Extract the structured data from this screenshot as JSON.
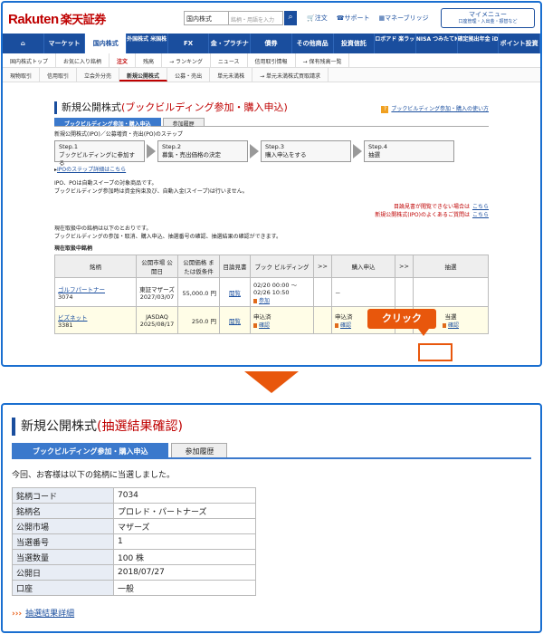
{
  "header": {
    "logo_en": "Rakuten",
    "logo_jp": "楽天証券",
    "search_select": "国内株式",
    "search_placeholder": "銘柄・用語を入力",
    "links": [
      "注文",
      "サポート",
      "マネーブリッジ"
    ],
    "mymenu_title": "マイメニュー",
    "mymenu_sub": "口座管理・入出金・振替など"
  },
  "nav": {
    "items": [
      "マーケット",
      "国内株式",
      "外国株式 米国株・海外ETF",
      "FX",
      "金・プラチナ",
      "債券",
      "その他商品",
      "投資信託",
      "ロボアド 楽ラップ",
      "NISA つみたてNISA",
      "確定拠出年金 iDeCo",
      "ポイント投資"
    ]
  },
  "subnav": {
    "items": [
      "国内株式トップ",
      "お気に入り銘柄",
      "注文",
      "残高",
      "→ ランキング",
      "ニュース",
      "信用取引情報",
      "→ 保有残高一覧"
    ]
  },
  "subnav2": {
    "items": [
      "現物取引",
      "信用取引",
      "立会外分売",
      "新規公開株式",
      "公募・売出",
      "単元未満株",
      "→ 単元未満株式買取請求"
    ]
  },
  "main": {
    "title_prefix": "新規公開株式",
    "title_suffix": "(ブックビルディング参加・購入申込)",
    "help": "ブックビルディング参加・購入の使い方",
    "tabs": [
      "ブックビルディング参加・購入申込",
      "参加履歴"
    ],
    "step_intro": "新規公開株式(IPO)／公募増資・売出(PO)のステップ",
    "steps": [
      {
        "head": "Step.1",
        "text": "ブックビルディングに参加する"
      },
      {
        "head": "Step.2",
        "text": "募集・売出価格の決定"
      },
      {
        "head": "Step.3",
        "text": "購入申込をする"
      },
      {
        "head": "Step.4",
        "text": "抽選"
      }
    ],
    "step_link": "IPOのステップ詳細はこちら",
    "note1": "IPO、POは自動スイープの対象商品です。",
    "note2": "ブックビルディング参加時は資金拘束及び、自動入金(スイープ)は行いません。",
    "warn1": "目論見書が閲覧できない場合は",
    "warn2": "新規公開株式(IPO)のよくあるご質問は",
    "here": "こちら",
    "list_intro1": "現在取扱中の銘柄は以下のとおりです。",
    "list_intro2": "ブックビルディングの参加・取消、購入申込、抽選番号の確認、抽選結果の確認ができます。",
    "list_heading": "現在取扱中銘柄",
    "table_headers": [
      "銘柄",
      "公開市場 公開日",
      "公開価格 または仮条件",
      "目論見書",
      "ブック ビルディング",
      ">>",
      "購入申込",
      ">>",
      "抽選"
    ],
    "rows": [
      {
        "name": "ゴルフパートナー",
        "code": "3074",
        "market": "東証マザーズ",
        "date": "2027/03/07",
        "price": "55,000.0 円",
        "doc": "閲覧",
        "bb": "02/20 00:00 ～ 02/26 10:50",
        "bb_action": "参加",
        "apply": "－",
        "lottery": ""
      },
      {
        "name": "ビズネット",
        "code": "3381",
        "market": "JASDAQ",
        "date": "2025/08/17",
        "price": "250.0 円",
        "doc": "閲覧",
        "bb": "申込済",
        "bb_action": "確認",
        "apply": "申込済",
        "apply_action": "確認",
        "lottery": "当選",
        "lottery_action": "確認"
      }
    ],
    "click_label": "クリック"
  },
  "result": {
    "title_prefix": "新規公開株式",
    "title_suffix": "(抽選結果確認)",
    "tabs": [
      "ブックビルディング参加・購入申込",
      "参加履歴"
    ],
    "message": "今回、お客様は以下の銘柄に当選しました。",
    "rows": [
      {
        "k": "銘柄コード",
        "v": "7034"
      },
      {
        "k": "銘柄名",
        "v": "プロレド・パートナーズ"
      },
      {
        "k": "公開市場",
        "v": "マザーズ"
      },
      {
        "k": "当選番号",
        "v": "1"
      },
      {
        "k": "当選数量",
        "v": "100 株"
      },
      {
        "k": "公開日",
        "v": "2018/07/27"
      },
      {
        "k": "口座",
        "v": "一般"
      }
    ],
    "detail_link": "抽選結果詳細"
  }
}
